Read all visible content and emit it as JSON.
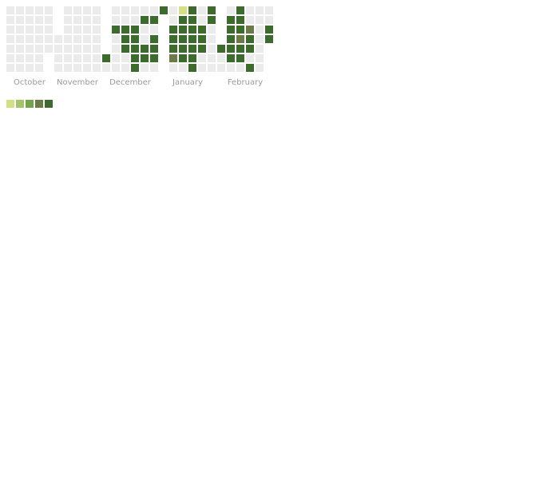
{
  "chart_data": {
    "type": "heatmap",
    "layout": "calendar",
    "title": "",
    "months": [
      {
        "label": "October",
        "cells": [
          [
            0,
            0,
            0,
            0,
            0,
            0,
            0
          ],
          [
            0,
            0,
            0,
            0,
            0,
            0,
            0
          ],
          [
            0,
            0,
            0,
            0,
            0,
            0,
            0
          ],
          [
            0,
            0,
            0,
            0,
            0,
            0,
            0
          ],
          [
            0,
            0,
            0,
            0,
            0,
            null,
            null
          ]
        ]
      },
      {
        "label": "November",
        "cells": [
          [
            null,
            null,
            null,
            0,
            0,
            0,
            0
          ],
          [
            0,
            0,
            0,
            0,
            0,
            0,
            0
          ],
          [
            0,
            0,
            0,
            0,
            0,
            0,
            0
          ],
          [
            0,
            0,
            0,
            0,
            0,
            0,
            0
          ],
          [
            0,
            0,
            0,
            0,
            0,
            0,
            0
          ]
        ]
      },
      {
        "label": "December",
        "cells": [
          [
            null,
            null,
            null,
            null,
            null,
            5,
            0
          ],
          [
            0,
            0,
            5,
            0,
            0,
            0,
            0
          ],
          [
            0,
            0,
            5,
            5,
            5,
            0,
            0
          ],
          [
            0,
            0,
            5,
            5,
            5,
            5,
            5
          ],
          [
            0,
            5,
            0,
            0,
            5,
            5,
            0
          ],
          [
            0,
            5,
            0,
            5,
            5,
            5,
            0
          ]
        ]
      },
      {
        "label": "January",
        "cells": [
          [
            5,
            null,
            null,
            null,
            null,
            null,
            null
          ],
          [
            0,
            0,
            5,
            5,
            5,
            4,
            0
          ],
          [
            1,
            5,
            5,
            5,
            5,
            5,
            0
          ],
          [
            5,
            5,
            5,
            5,
            5,
            5,
            5
          ],
          [
            0,
            0,
            5,
            5,
            5,
            0,
            0
          ],
          [
            5,
            5,
            0,
            0,
            0,
            0,
            0
          ]
        ]
      },
      {
        "label": "February",
        "cells": [
          [
            null,
            null,
            null,
            null,
            5,
            0,
            0
          ],
          [
            0,
            5,
            5,
            5,
            5,
            5,
            0
          ],
          [
            5,
            5,
            5,
            4,
            5,
            5,
            0
          ],
          [
            0,
            0,
            4,
            5,
            5,
            0,
            5
          ],
          [
            0,
            0,
            0,
            0,
            0,
            0,
            0
          ],
          [
            0,
            0,
            5,
            5,
            null,
            null,
            null
          ]
        ]
      }
    ],
    "legend": {
      "levels": [
        1,
        2,
        3,
        4,
        5
      ]
    },
    "colors": {
      "empty": "#ebebeb",
      "1": "#d5df85",
      "2": "#a3c46a",
      "3": "#73a449",
      "4": "#6b7a48",
      "5": "#3d6b2e"
    }
  }
}
